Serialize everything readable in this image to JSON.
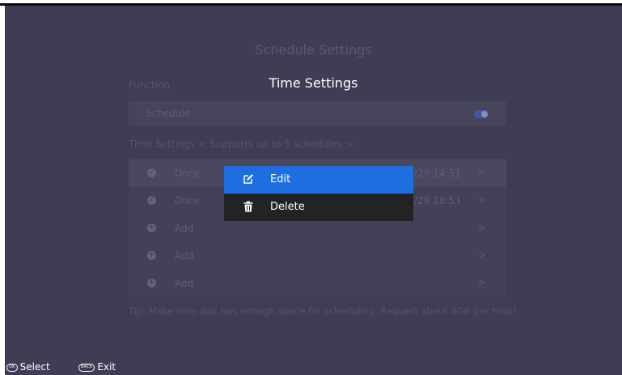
{
  "background": {
    "title": "Schedule Settings",
    "function_label": "Function",
    "schedule_label": "Schedule",
    "time_settings_label": "Time Settings < Supports up to 5 schedules >",
    "rows": [
      {
        "status": "check",
        "text": "Once",
        "time": "/29 14:51",
        "chevron": ">"
      },
      {
        "status": "check",
        "text": "Once",
        "time": "/29 18:53",
        "chevron": ">"
      },
      {
        "status": "plus",
        "text": "Add",
        "time": "",
        "chevron": ">"
      },
      {
        "status": "plus",
        "text": "Add",
        "time": "",
        "chevron": ">"
      },
      {
        "status": "plus",
        "text": "Add",
        "time": "",
        "chevron": ">"
      }
    ],
    "tip": "Tip: Make sure disk has enough space for scheduling. Request about 8GB per hour!"
  },
  "dialog": {
    "title": "Time Settings",
    "items": [
      {
        "icon": "edit-icon",
        "label": "Edit",
        "selected": true
      },
      {
        "icon": "trash-icon",
        "label": "Delete",
        "selected": false
      }
    ]
  },
  "footer": {
    "select_key": "OK",
    "select_label": "Select",
    "exit_key": "BACK",
    "exit_label": "Exit"
  },
  "colors": {
    "background": "#3f3d53",
    "menu_background": "#232323",
    "accent": "#1d6fe0"
  }
}
